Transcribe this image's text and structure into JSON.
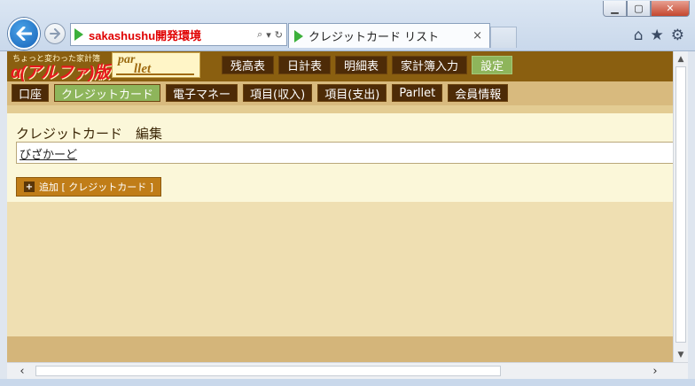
{
  "browser": {
    "address_text": "sakashushu開発環境",
    "tab_title": "クレジットカード リスト",
    "tab_close": "×",
    "window_controls": {
      "minimize": "▁",
      "maximize": "▢",
      "close": "✕"
    },
    "toolbar_icons": [
      "home-icon",
      "favorites-star-icon",
      "settings-gear-icon"
    ]
  },
  "site": {
    "logo_small": "ちょっと変わった家計簿",
    "logo_big": "α(アルファ)版",
    "logo_box_line1": "par",
    "logo_box_line2": "llet"
  },
  "top_nav": [
    {
      "label": "残高表",
      "active": false
    },
    {
      "label": "日計表",
      "active": false
    },
    {
      "label": "明細表",
      "active": false
    },
    {
      "label": "家計簿入力",
      "active": false
    },
    {
      "label": "設定",
      "active": true
    }
  ],
  "sub_nav": [
    {
      "label": "口座",
      "active": false
    },
    {
      "label": "クレジットカード",
      "active": true
    },
    {
      "label": "電子マネー",
      "active": false
    },
    {
      "label": "項目(収入)",
      "active": false
    },
    {
      "label": "項目(支出)",
      "active": false
    },
    {
      "label": "Parllet",
      "active": false
    },
    {
      "label": "会員情報",
      "active": false
    }
  ],
  "main": {
    "heading": "クレジットカード　編集",
    "items": [
      "びざかーど"
    ],
    "add_button_label": "追加 [ クレジットカード ]",
    "add_button_icon": "+"
  },
  "colors": {
    "header_brown": "#8a5f10",
    "nav_dark": "#4d2b07",
    "active_green": "#8eb55b",
    "page_bg": "#efdfb2"
  }
}
